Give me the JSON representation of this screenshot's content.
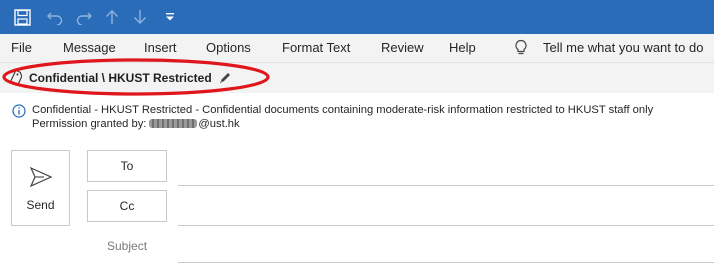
{
  "colors": {
    "accent": "#2b6cb8",
    "annotation": "#e0161d",
    "info": "#1e6bbd"
  },
  "quick_access": {
    "icons": [
      "save-icon",
      "undo-icon",
      "redo-icon",
      "up-arrow-icon",
      "down-arrow-icon",
      "customize-toolbar-icon"
    ]
  },
  "menu": {
    "items": [
      "File",
      "Message",
      "Insert",
      "Options",
      "Format Text",
      "Review",
      "Help"
    ],
    "tell_me": "Tell me what you want to do"
  },
  "sensitivity": {
    "label": "Confidential \\ HKUST Restricted"
  },
  "info": {
    "line1": "Confidential - HKUST Restricted - Confidential documents  containing moderate-risk information restricted to HKUST staff only",
    "permission_prefix": "Permission granted by:",
    "permission_suffix": "@ust.hk"
  },
  "compose": {
    "send_label": "Send",
    "to_label": "To",
    "cc_label": "Cc",
    "subject_label": "Subject"
  }
}
